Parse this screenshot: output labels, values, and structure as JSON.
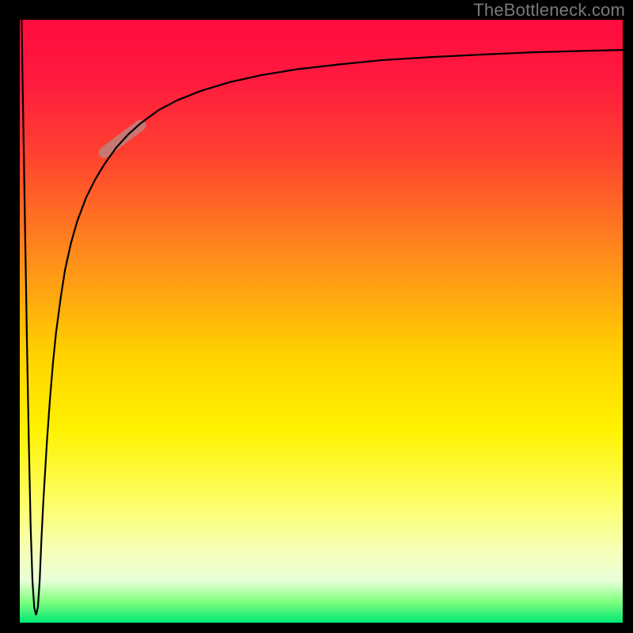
{
  "watermark": "TheBottleneck.com",
  "chart_data": {
    "type": "line",
    "title": "",
    "xlabel": "",
    "ylabel": "",
    "xlim": [
      0,
      100
    ],
    "ylim": [
      0,
      100
    ],
    "grid": false,
    "legend": false,
    "gradient_stops": [
      {
        "offset": 0.0,
        "color": "#ff0b3e"
      },
      {
        "offset": 0.1,
        "color": "#ff1b3e"
      },
      {
        "offset": 0.22,
        "color": "#ff4030"
      },
      {
        "offset": 0.4,
        "color": "#ff8f1a"
      },
      {
        "offset": 0.55,
        "color": "#ffd000"
      },
      {
        "offset": 0.68,
        "color": "#fff200"
      },
      {
        "offset": 0.8,
        "color": "#fdff66"
      },
      {
        "offset": 0.88,
        "color": "#f6ffb8"
      },
      {
        "offset": 0.93,
        "color": "#e8ffd8"
      },
      {
        "offset": 0.965,
        "color": "#7fff7f"
      },
      {
        "offset": 1.0,
        "color": "#00e874"
      }
    ],
    "highlight_segment": {
      "x1": 14,
      "y1": 78,
      "x2": 20,
      "y2": 82.5
    },
    "series": [
      {
        "name": "curve",
        "x": [
          0.3,
          0.6,
          0.9,
          1.2,
          1.5,
          1.8,
          2.1,
          2.4,
          2.7,
          3.0,
          3.3,
          3.6,
          3.9,
          4.5,
          5.0,
          5.5,
          6.0,
          6.8,
          7.5,
          8.5,
          9.5,
          11,
          12.5,
          14,
          16,
          18,
          20,
          23,
          26,
          30,
          35,
          40,
          46,
          53,
          60,
          68,
          76,
          85,
          92,
          100
        ],
        "y": [
          100,
          82,
          64,
          46,
          30,
          16,
          7,
          2.5,
          1.3,
          2.5,
          7,
          14,
          20,
          30,
          37,
          43,
          48,
          54,
          58.5,
          63,
          66.5,
          70.5,
          73.5,
          76,
          78.8,
          81,
          82.8,
          85,
          86.6,
          88.2,
          89.7,
          90.8,
          91.8,
          92.6,
          93.3,
          93.8,
          94.2,
          94.6,
          94.8,
          95.0
        ]
      }
    ]
  }
}
